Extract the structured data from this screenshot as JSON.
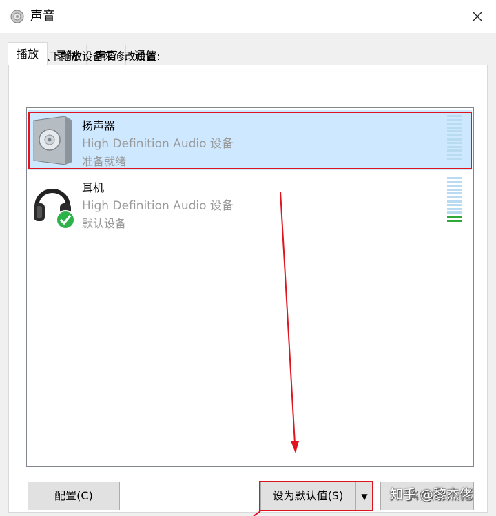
{
  "window": {
    "title": "声音",
    "close_glyph": "×"
  },
  "tabs": [
    {
      "label": "播放",
      "active": true
    },
    {
      "label": "录制",
      "active": false
    },
    {
      "label": "声音",
      "active": false
    },
    {
      "label": "通信",
      "active": false
    }
  ],
  "instruction": "选择以下播放设备来修改设置:",
  "devices": [
    {
      "name": "扬声器",
      "description": "High Definition Audio 设备",
      "status": "准备就绪",
      "icon": "speaker-icon",
      "selected": true
    },
    {
      "name": "耳机",
      "description": "High Definition Audio 设备",
      "status": "默认设备",
      "icon": "headphones-icon",
      "default_badge": "green-check-icon",
      "selected": false
    }
  ],
  "buttons": {
    "configure": "配置(C)",
    "set_default": "设为默认值(S)",
    "set_default_dropdown_glyph": "▼",
    "properties": "属性(P)"
  },
  "watermark": "知乎 @黎杰佬",
  "colors": {
    "selection": "#cde8ff",
    "annotation_red": "#e0141e",
    "meter_idle": "#b9dbf1",
    "meter_active": "#31a83a",
    "check_green": "#2eb24a"
  }
}
